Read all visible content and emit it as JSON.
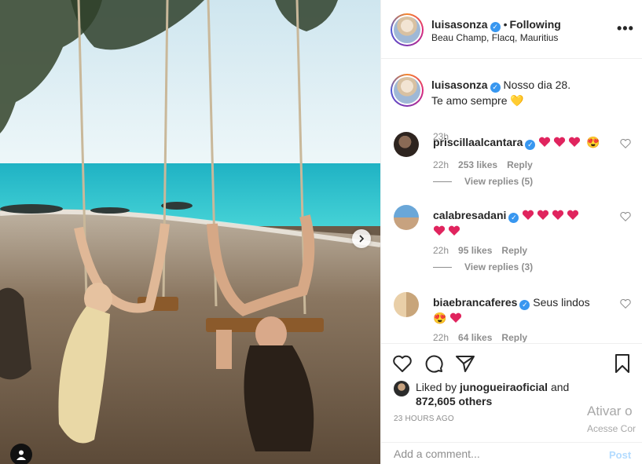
{
  "post": {
    "username": "luisasonza",
    "follow_dot": "•",
    "follow_label": "Following",
    "location": "Beau Champ, Flacq, Mauritius",
    "more_label": "•••"
  },
  "caption": {
    "username": "luisasonza",
    "text_line1": "Nosso dia 28.",
    "text_line2": "Te amo sempre",
    "emoji": "💛",
    "time": "23h"
  },
  "comments": [
    {
      "username": "priscillaalcantara",
      "hearts": 3,
      "extra_emoji": "😍",
      "time": "22h",
      "likes": "253 likes",
      "reply_label": "Reply",
      "view_replies": "View replies (5)"
    },
    {
      "username": "calabresadani",
      "hearts": 6,
      "time": "22h",
      "likes": "95 likes",
      "reply_label": "Reply",
      "view_replies": "View replies (3)"
    },
    {
      "username": "biaebrancaferes",
      "text": "Seus lindos",
      "lead_emoji": "😍",
      "hearts": 1,
      "time": "22h",
      "likes": "64 likes",
      "reply_label": "Reply"
    }
  ],
  "likes": {
    "prefix": "Liked by",
    "user": "junogueiraoficial",
    "and": "and",
    "count": "872,605 others"
  },
  "timestamp": "23 HOURS AGO",
  "watermark": {
    "line1": "Ativar o",
    "line2": "Acesse Cor"
  },
  "comment_box": {
    "placeholder": "Add a comment...",
    "post_label": "Post"
  },
  "colors": {
    "verified": "#3897f0",
    "heart_red": "#ed4956",
    "post_disabled": "#b3dbff"
  }
}
